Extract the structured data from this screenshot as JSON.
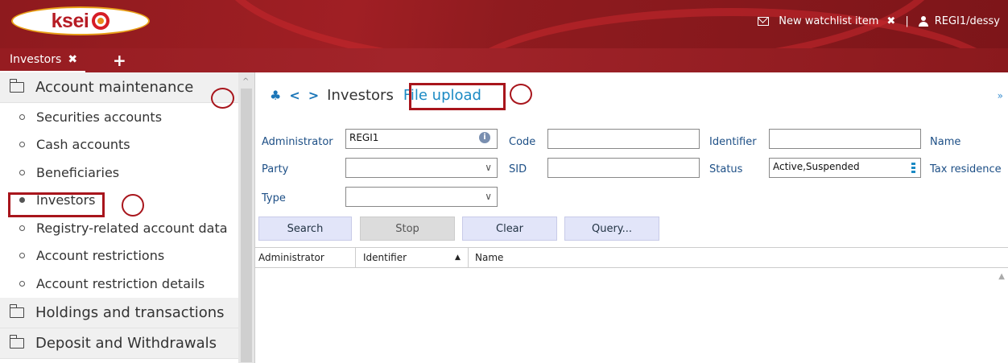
{
  "header": {
    "logo_text": "ksei",
    "watchlist_label": "New watchlist item",
    "watchlist_close": "✖",
    "separator": "|",
    "user": "REGI1/dessy"
  },
  "tabs": {
    "active_label": "Investors",
    "close_glyph": "✖",
    "add_glyph": "+"
  },
  "sidebar": {
    "groups": {
      "account": "Account maintenance",
      "holdings": "Holdings and transactions",
      "deposit": "Deposit and Withdrawals"
    },
    "items": [
      {
        "label": "Securities accounts",
        "selected": false
      },
      {
        "label": "Cash accounts",
        "selected": false
      },
      {
        "label": "Beneficiaries",
        "selected": false
      },
      {
        "label": "Investors",
        "selected": true
      },
      {
        "label": "Registry-related account data",
        "selected": false
      },
      {
        "label": "Account restrictions",
        "selected": false
      },
      {
        "label": "Account restriction details",
        "selected": false
      }
    ]
  },
  "breadcrumb": {
    "current": "Investors",
    "link": "File upload"
  },
  "form": {
    "administrator_label": "Administrator",
    "administrator_value": "REGI1",
    "code_label": "Code",
    "code_value": "",
    "identifier_label": "Identifier",
    "identifier_value": "",
    "name_label": "Name",
    "party_label": "Party",
    "party_value": "",
    "sid_label": "SID",
    "sid_value": "",
    "status_label": "Status",
    "status_value": "Active,Suspended",
    "tax_label": "Tax residence",
    "type_label": "Type",
    "type_value": ""
  },
  "buttons": {
    "search": "Search",
    "stop": "Stop",
    "clear": "Clear",
    "query": "Query..."
  },
  "grid": {
    "columns": [
      "Administrator",
      "Identifier",
      "Name"
    ],
    "sort_column": "Identifier",
    "sort_direction": "ascending"
  },
  "colors": {
    "brand_red": "#a01f24",
    "highlight": "#a8151c",
    "link_blue": "#1b8ac4",
    "label_blue": "#1d4f86"
  }
}
